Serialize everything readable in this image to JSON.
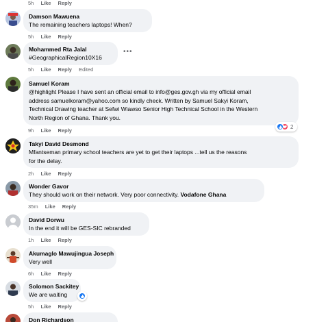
{
  "colors": {
    "bubble": "#f0f2f5",
    "meta_text": "#65676b",
    "like_blue": "#1877f2",
    "love_red": "#f33e58"
  },
  "top_partial": {
    "time": "5h",
    "like": "Like",
    "reply": "Reply"
  },
  "comments": [
    {
      "author": "Damson Mawuena",
      "text": "The remaining teachers laptops! When?",
      "time": "5h",
      "like": "Like",
      "reply": "Reply"
    },
    {
      "author": "Mohammed Rta Jalal",
      "text": "#GeographicalRegion10X16",
      "time": "5h",
      "like": "Like",
      "reply": "Reply",
      "edited": "Edited",
      "more_icon": "more-horizontal-icon"
    },
    {
      "author": "Samuel Koram",
      "lines": [
        "@highlight Please I have sent an official email to info@ges.gov.gh via my official email",
        "address samuelkoram@yahoo.com so kindly check. Written by Samuel Sakyi Koram,",
        "Technical Drawing teacher at Sefwi Wiawso Senior High Technical School in the Western",
        "North Region of Ghana. Thank you."
      ],
      "time": "9h",
      "like": "Like",
      "reply": "Reply",
      "reaction_count": "2",
      "reaction_icons": [
        "like-reaction-icon",
        "love-reaction-icon"
      ]
    },
    {
      "author": "Takyi David Desmond",
      "lines": [
        "Mfantseman primary school teachers are yet to get their laptops ...tell us the reasons",
        "for the delay."
      ],
      "time": "2h",
      "like": "Like",
      "reply": "Reply"
    },
    {
      "author": "Wonder Gavor",
      "text": "They should work on their network. Very poor connectivity.",
      "tag": "Vodafone Ghana",
      "time": "35m",
      "like": "Like",
      "reply": "Reply"
    },
    {
      "author": "David Dorwu",
      "text": "In the end it will be GES-SIC rebranded",
      "time": "1h",
      "like": "Like",
      "reply": "Reply"
    },
    {
      "author": "Akumaglo Mawujingua Joseph",
      "text": "Very well",
      "time": "6h",
      "like": "Like",
      "reply": "Reply"
    },
    {
      "author": "Solomon Sackitey",
      "text": "We are waiting",
      "time": "5h",
      "like": "Like",
      "reply": "Reply",
      "reaction_icons": [
        "like-reaction-icon"
      ]
    },
    {
      "author": "Don Richardson"
    }
  ]
}
